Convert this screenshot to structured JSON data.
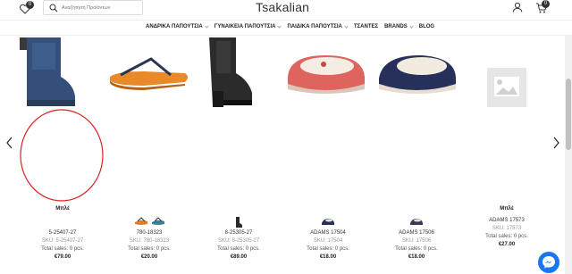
{
  "header": {
    "logo": "Tsakalian",
    "search_placeholder": "Αναζήτηση Προϊόντων",
    "wishlist_count": "0",
    "cart_count": "0"
  },
  "nav": {
    "items": [
      "ΑΝΔΡΙΚΑ ΠΑΠΟΥΤΣΙΑ",
      "ΓΥΝΑΙΚΕΙΑ ΠΑΠΟΥΤΣΙΑ",
      "ΠΑΙΔΙΚΑ ΠΑΠΟΥΤΣΙΑ",
      "ΤΣΑΝΤΕΣ",
      "BRANDS",
      "BLOG"
    ]
  },
  "products": [
    {
      "brand": "Mπλέ",
      "name": "5-25407-27",
      "sku": "SKU: 5-25407-27",
      "sales": "Total sales: 0 pcs.",
      "price": "€79.00"
    },
    {
      "brand": "",
      "name": "780-18323",
      "sku": "SKU: 780-18323",
      "sales": "Total sales: 0 pcs.",
      "price": "€20.00"
    },
    {
      "brand": "",
      "name": "8-25305-27",
      "sku": "SKU: 8-25305-27",
      "sales": "Total sales: 0 pcs.",
      "price": "€89.00"
    },
    {
      "brand": "",
      "name": "ADAMS 17504",
      "sku": "SKU: 17504",
      "sales": "Total sales: 0 pcs.",
      "price": "€18.00"
    },
    {
      "brand": "",
      "name": "ADAMS 17506",
      "sku": "SKU: 17506",
      "sales": "Total sales: 0 pcs.",
      "price": "€18.00"
    },
    {
      "brand": "Mπλέ",
      "name": "ADAMS 17573",
      "sku": "SKU: 17573",
      "sales": "Total sales: 0 pcs.",
      "price": "€27.00"
    }
  ],
  "colors": {
    "accent": "#1877f2",
    "annotation_circle": "#e02020",
    "text": "#222222"
  },
  "icons": [
    "heart-icon",
    "search-icon",
    "user-icon",
    "cart-icon",
    "chevron-left-icon",
    "chevron-right-icon",
    "messenger-icon",
    "image-placeholder-icon"
  ]
}
